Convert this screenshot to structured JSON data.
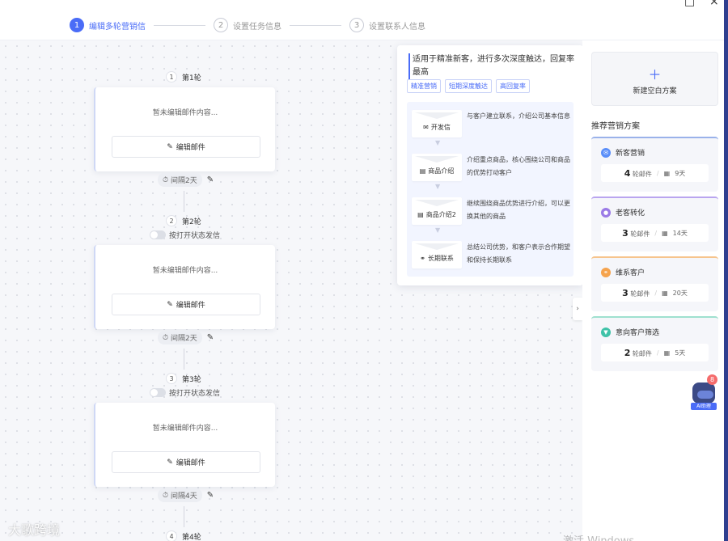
{
  "window": {
    "maximize_icon": "□",
    "close_icon": "×"
  },
  "steps": [
    {
      "num": "1",
      "label": "编辑多轮营销信",
      "active": true
    },
    {
      "num": "2",
      "label": "设置任务信息",
      "active": false
    },
    {
      "num": "3",
      "label": "设置联系人信息",
      "active": false
    }
  ],
  "rounds": [
    {
      "num": "1",
      "label": "第1轮",
      "toggle_label": "",
      "empty_text": "暂未编辑邮件内容...",
      "edit_label": "编辑邮件",
      "interval": "间隔2天"
    },
    {
      "num": "2",
      "label": "第2轮",
      "toggle_label": "按打开状态发信",
      "empty_text": "暂未编辑邮件内容...",
      "edit_label": "编辑邮件",
      "interval": "间隔2天"
    },
    {
      "num": "3",
      "label": "第3轮",
      "toggle_label": "按打开状态发信",
      "empty_text": "暂未编辑邮件内容...",
      "edit_label": "编辑邮件",
      "interval": "间隔4天"
    },
    {
      "num": "4",
      "label": "第4轮"
    }
  ],
  "popover": {
    "description": "适用于精准新客，进行多次深度触达，回复率最高",
    "tags": [
      "精准营销",
      "短期深度触达",
      "高回复率"
    ],
    "flow": [
      {
        "label": "开发信",
        "text": "与客户建立联系，介绍公司基本信息"
      },
      {
        "label": "商品介绍",
        "text": "介绍重点商品，核心围绕公司和商品的优势打动客户"
      },
      {
        "label": "商品介绍2",
        "text": "继续围绕商品优势进行介绍，可以更换其他的商品"
      },
      {
        "label": "长期联系",
        "text": "总结公司优势，和客户表示合作期望和保持长期联系"
      }
    ]
  },
  "sidebar": {
    "new_plan_label": "新建空白方案",
    "recommend_title": "推荐营销方案",
    "plans": [
      {
        "name": "新客营销",
        "rounds": "4",
        "rounds_unit": "轮邮件",
        "days": "9天",
        "color": "#5b8ff9",
        "accent": "#9ab2ea"
      },
      {
        "name": "老客转化",
        "rounds": "3",
        "rounds_unit": "轮邮件",
        "days": "14天",
        "color": "#9b7be6",
        "accent": "#b9a5ef"
      },
      {
        "name": "维系客户",
        "rounds": "3",
        "rounds_unit": "轮邮件",
        "days": "20天",
        "color": "#f5a34d",
        "accent": "#f6c48c"
      },
      {
        "name": "意向客户筛选",
        "rounds": "2",
        "rounds_unit": "轮邮件",
        "days": "5天",
        "color": "#3fc2a8",
        "accent": "#9fe0cf"
      }
    ]
  },
  "ai_assistant": {
    "label": "AI助理",
    "badge": "8"
  },
  "watermark": "大歌跨境",
  "os_watermark": "激活 Windows"
}
